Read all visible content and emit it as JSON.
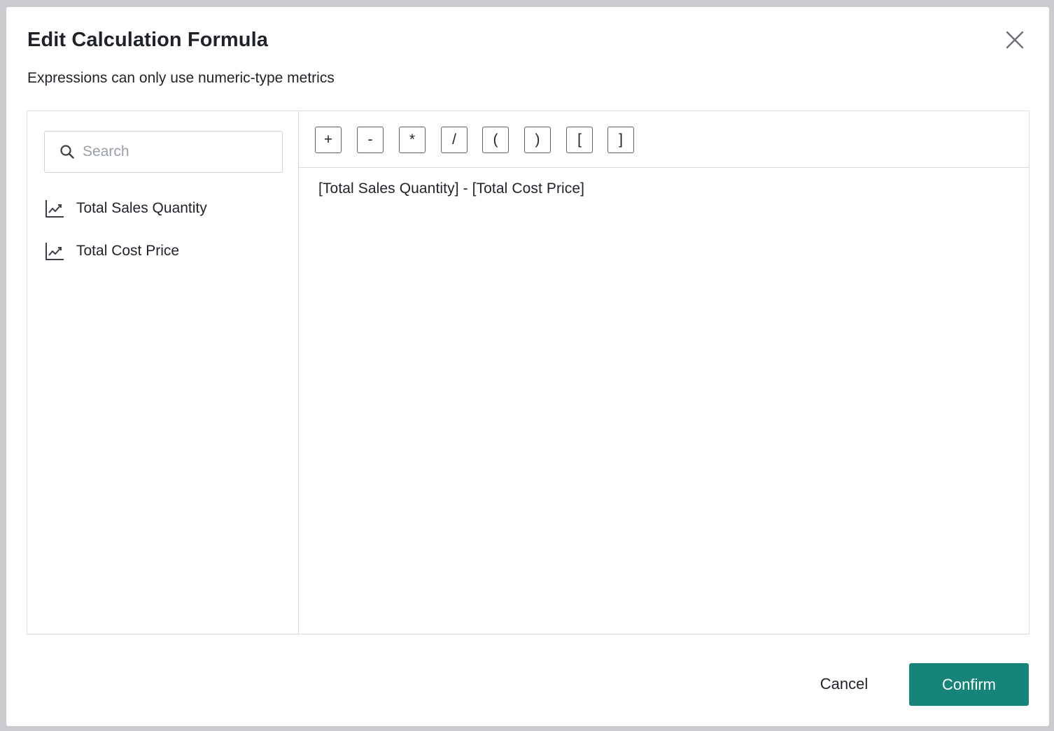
{
  "dialog": {
    "title": "Edit Calculation Formula",
    "subtitle": "Expressions can only use numeric-type metrics",
    "close_icon": "close-icon"
  },
  "sidebar": {
    "search": {
      "placeholder": "Search",
      "value": "",
      "icon": "search-icon"
    },
    "metrics": [
      {
        "label": "Total Sales Quantity",
        "icon": "line-chart-icon"
      },
      {
        "label": "Total Cost Price",
        "icon": "line-chart-icon"
      }
    ]
  },
  "toolbar": {
    "operators": [
      "+",
      "-",
      "*",
      "/",
      "(",
      ")",
      "[",
      "]"
    ]
  },
  "editor": {
    "formula": "[Total Sales Quantity] - [Total Cost Price]"
  },
  "footer": {
    "cancel_label": "Cancel",
    "confirm_label": "Confirm"
  },
  "colors": {
    "primary": "#17847a",
    "text": "#1f2329",
    "border": "#d9dbe0",
    "placeholder": "#9aa0a8"
  }
}
